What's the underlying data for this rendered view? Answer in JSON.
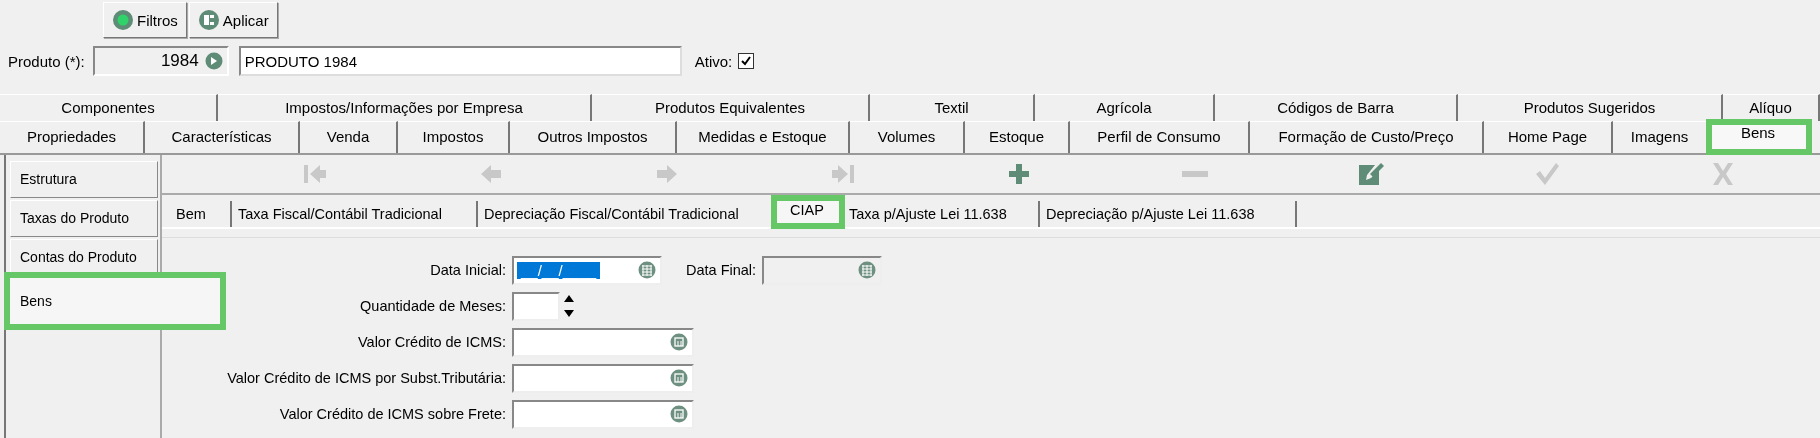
{
  "action_buttons": [
    {
      "label": "Filtros",
      "kind": "filter"
    },
    {
      "label": "Aplicar",
      "kind": "apply"
    }
  ],
  "product": {
    "label": "Produto (*):",
    "code": "1984",
    "name": "PRODUTO 1984",
    "active_label": "Ativo:",
    "active": true
  },
  "tabs_row_1": [
    {
      "label": "Componentes",
      "selected": false
    },
    {
      "label": "Impostos/Informações por Empresa",
      "selected": false
    },
    {
      "label": "Produtos Equivalentes",
      "selected": false
    },
    {
      "label": "Textil",
      "selected": false
    },
    {
      "label": "Agrícola",
      "selected": false
    },
    {
      "label": "Códigos de Barra",
      "selected": false
    },
    {
      "label": "Produtos Sugeridos",
      "selected": false
    },
    {
      "label": "Alíquo",
      "selected": false
    }
  ],
  "tabs_row_2": [
    {
      "label": "Propriedades",
      "selected": false
    },
    {
      "label": "Características",
      "selected": false
    },
    {
      "label": "Venda",
      "selected": false
    },
    {
      "label": "Impostos",
      "selected": false
    },
    {
      "label": "Outros Impostos",
      "selected": false
    },
    {
      "label": "Medidas e Estoque",
      "selected": false
    },
    {
      "label": "Volumes",
      "selected": false
    },
    {
      "label": "Estoque",
      "selected": false
    },
    {
      "label": "Perfil de Consumo",
      "selected": false
    },
    {
      "label": "Formação de Custo/Preço",
      "selected": false
    },
    {
      "label": "Home Page",
      "selected": false
    },
    {
      "label": "Imagens",
      "selected": false
    },
    {
      "label": "Bens",
      "selected": true,
      "highlighted": true
    }
  ],
  "sidebar": {
    "items": [
      {
        "label": "Estrutura",
        "selected": false
      },
      {
        "label": "Taxas do Produto",
        "selected": false
      },
      {
        "label": "Contas do Produto",
        "selected": false
      },
      {
        "label": "Bens",
        "selected": true,
        "highlighted": true
      }
    ]
  },
  "toolbar": [
    {
      "kind": "first",
      "disabled": true
    },
    {
      "kind": "prev",
      "disabled": true
    },
    {
      "kind": "next",
      "disabled": true
    },
    {
      "kind": "last",
      "disabled": true
    },
    {
      "kind": "add",
      "disabled": false
    },
    {
      "kind": "remove",
      "disabled": true
    },
    {
      "kind": "edit",
      "disabled": false
    },
    {
      "kind": "confirm",
      "disabled": true
    },
    {
      "kind": "cancel",
      "disabled": true
    }
  ],
  "sub_tabs": [
    {
      "label": "Bem",
      "selected": false
    },
    {
      "label": "Taxa Fiscal/Contábil Tradicional",
      "selected": false
    },
    {
      "label": "Depreciação Fiscal/Contábil Tradicional",
      "selected": false
    },
    {
      "label": "CIAP",
      "selected": true,
      "highlighted": true
    },
    {
      "label": "Taxa p/Ajuste Lei 11.638",
      "selected": false
    },
    {
      "label": "Depreciação p/Ajuste Lei 11.638",
      "selected": false
    }
  ],
  "form": {
    "data_inicial": {
      "label": "Data Inicial:",
      "value": "__/__/____",
      "selected": true
    },
    "data_final": {
      "label": "Data Final:",
      "disabled": true
    },
    "quantidade_meses": {
      "label": "Quantidade de Meses:"
    },
    "valores": [
      {
        "label": "Valor Crédito de ICMS:"
      },
      {
        "label": "Valor Crédito de ICMS por Subst.Tributária:"
      },
      {
        "label": "Valor Crédito de ICMS sobre Frete:"
      }
    ]
  }
}
